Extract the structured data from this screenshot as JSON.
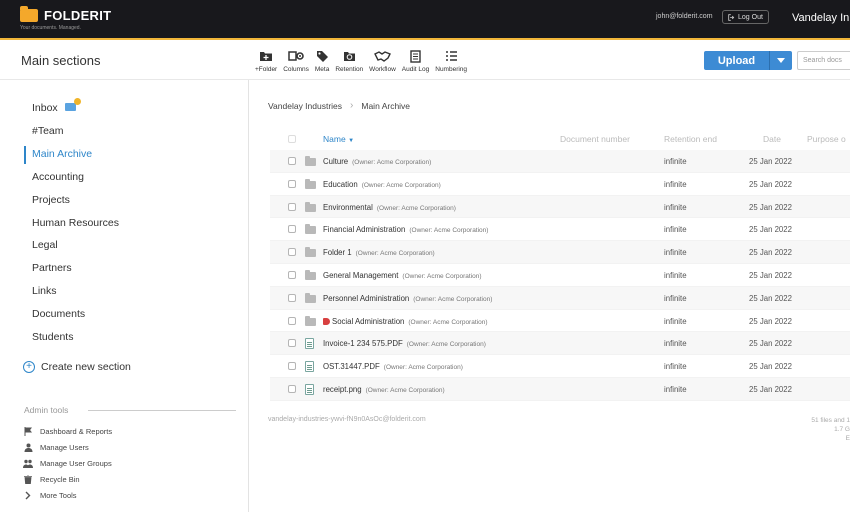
{
  "topbar": {
    "logo_text": "FOLDERIT",
    "tagline": "Your documents. Managed.",
    "user_email": "john@folderit.com",
    "logout_label": "Log Out",
    "org_name": "Vandelay In",
    "accent_color": "#f1b73a"
  },
  "header": {
    "title": "Main sections",
    "toolbar": [
      {
        "label": "+Folder",
        "icon": "folder-plus-icon"
      },
      {
        "label": "Columns",
        "icon": "columns-icon"
      },
      {
        "label": "Meta",
        "icon": "tag-icon"
      },
      {
        "label": "Retention",
        "icon": "retention-icon"
      },
      {
        "label": "Workflow",
        "icon": "handshake-icon"
      },
      {
        "label": "Audit Log",
        "icon": "document-icon"
      },
      {
        "label": "Numbering",
        "icon": "numbered-list-icon"
      }
    ],
    "upload_label": "Upload",
    "search_placeholder": "Search docs"
  },
  "sidebar": {
    "items": [
      {
        "label": "Inbox"
      },
      {
        "label": "#Team"
      },
      {
        "label": "Main Archive",
        "active": true
      },
      {
        "label": "Accounting"
      },
      {
        "label": "Projects"
      },
      {
        "label": "Human Resources"
      },
      {
        "label": "Legal"
      },
      {
        "label": "Partners"
      },
      {
        "label": "Links"
      },
      {
        "label": "Documents"
      },
      {
        "label": "Students"
      }
    ],
    "create_label": "Create new section",
    "admin_title": "Admin tools",
    "admin_items": [
      {
        "label": "Dashboard & Reports",
        "icon": "flag-icon"
      },
      {
        "label": "Manage Users",
        "icon": "user-icon"
      },
      {
        "label": "Manage User Groups",
        "icon": "users-icon"
      },
      {
        "label": "Recycle Bin",
        "icon": "trash-icon"
      },
      {
        "label": "More Tools",
        "icon": "chevron-right-icon"
      }
    ]
  },
  "main": {
    "breadcrumb": [
      "Vandelay Industries",
      "Main Archive"
    ],
    "columns": {
      "name": "Name",
      "doc_number": "Document number",
      "retention": "Retention end",
      "date": "Date",
      "purpose": "Purpose o"
    },
    "rows": [
      {
        "name": "Culture",
        "owner": "(Owner: Acme Corporation)",
        "retention": "infinite",
        "date": "25 Jan 2022",
        "type": "folder"
      },
      {
        "name": "Education",
        "owner": "(Owner: Acme Corporation)",
        "retention": "infinite",
        "date": "25 Jan 2022",
        "type": "folder"
      },
      {
        "name": "Environmental",
        "owner": "(Owner: Acme Corporation)",
        "retention": "infinite",
        "date": "25 Jan 2022",
        "type": "folder"
      },
      {
        "name": "Financial Administration",
        "owner": "(Owner: Acme Corporation)",
        "retention": "infinite",
        "date": "25 Jan 2022",
        "type": "folder"
      },
      {
        "name": "Folder 1",
        "owner": "(Owner: Acme Corporation)",
        "retention": "infinite",
        "date": "25 Jan 2022",
        "type": "folder"
      },
      {
        "name": "General Management",
        "owner": "(Owner: Acme Corporation)",
        "retention": "infinite",
        "date": "25 Jan 2022",
        "type": "folder"
      },
      {
        "name": "Personnel Administration",
        "owner": "(Owner: Acme Corporation)",
        "retention": "infinite",
        "date": "25 Jan 2022",
        "type": "folder"
      },
      {
        "name": "Social Administration",
        "owner": "(Owner: Acme Corporation)",
        "retention": "infinite",
        "date": "25 Jan 2022",
        "type": "folder",
        "tagged": true
      },
      {
        "name": "Invoice-1 234 575.PDF",
        "owner": "(Owner: Acme Corporation)",
        "retention": "infinite",
        "date": "25 Jan 2022",
        "type": "file"
      },
      {
        "name": "OST.31447.PDF",
        "owner": "(Owner: Acme Corporation)",
        "retention": "infinite",
        "date": "25 Jan 2022",
        "type": "file"
      },
      {
        "name": "receipt.png",
        "owner": "(Owner: Acme Corporation)",
        "retention": "infinite",
        "date": "25 Jan 2022",
        "type": "file"
      }
    ],
    "footer_email": "vandelay-industries-ywvi-fN9n0AsOc@folderit.com",
    "footer_counts": [
      "51 files and 1",
      "1.7 G",
      "E"
    ]
  }
}
